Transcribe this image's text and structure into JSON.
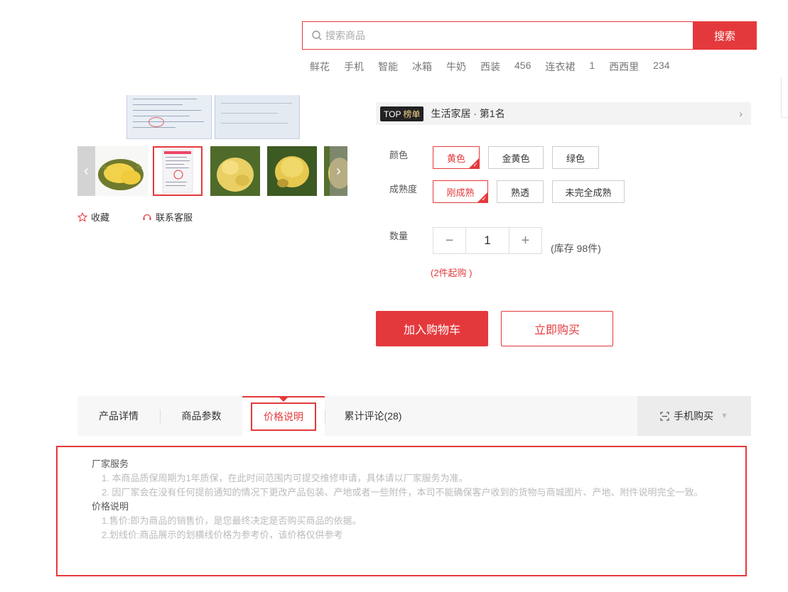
{
  "search": {
    "placeholder": "搜索商品",
    "button": "搜索"
  },
  "hotwords": [
    "鲜花",
    "手机",
    "智能",
    "冰箱",
    "牛奶",
    "西装",
    "456",
    "连衣裙",
    "1",
    "西西里",
    "234"
  ],
  "gallery": {
    "thumb_count": 5,
    "active_thumb": 2
  },
  "actions": {
    "favorite": "收藏",
    "service": "联系客服"
  },
  "ranking": {
    "badge_top": "TOP",
    "badge_label": "榜单",
    "text": "生活家居 · 第1名"
  },
  "options": {
    "color_label": "颜色",
    "colors": [
      "黄色",
      "金黄色",
      "绿色"
    ],
    "color_selected": "黄色",
    "ripeness_label": "成熟度",
    "ripeness": [
      "刚成熟",
      "熟透",
      "未完全成熟"
    ],
    "ripeness_selected": "刚成熟"
  },
  "quantity": {
    "label": "数量",
    "minus": "−",
    "value": "1",
    "plus": "+",
    "stock": "(库存 98件)",
    "min_purchase": "(2件起购 )"
  },
  "buttons": {
    "add_cart": "加入购物车",
    "buy_now": "立即购买"
  },
  "tabs": [
    "产品详情",
    "商品参数",
    "价格说明",
    "累计评论(28)"
  ],
  "active_tab": "价格说明",
  "mobile_buy": "手机购买",
  "content": {
    "heading1": "厂家服务",
    "para1": "1. 本商品质保周期为1年质保，在此时间范围内可提交维修申请，具体请以厂家服务为准。",
    "para2": "2. 因厂家会在没有任何提前通知的情况下更改产品包装、产地或者一些附件，本司不能确保客户收到的货物与商城图片、产地、附件说明完全一致。",
    "heading2": "价格说明",
    "para3": "1.售价:即为商品的销售价，是您最终决定是否购买商品的依据。",
    "para4": "2.划线价:商品展示的划横线价格为参考价，该价格仅供参考"
  },
  "colors": {
    "accent": "#e4393c",
    "muted": "#bbbbbb"
  }
}
